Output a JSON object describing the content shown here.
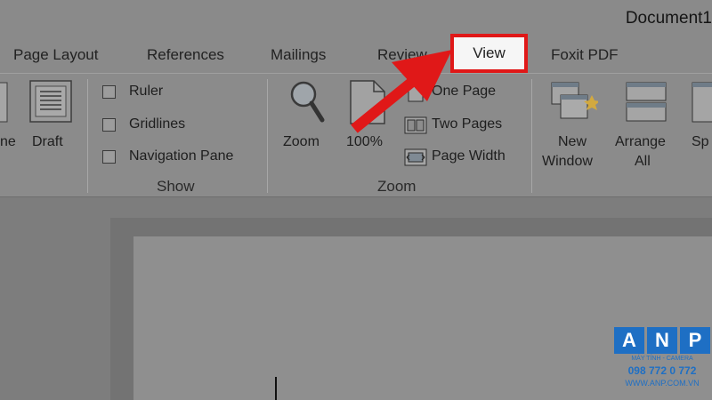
{
  "window": {
    "title": "Document1"
  },
  "tabs": [
    "Page Layout",
    "References",
    "Mailings",
    "Review",
    "View",
    "Foxit PDF"
  ],
  "ribbon": {
    "views": {
      "partial_label": "ne",
      "draft_label": "Draft"
    },
    "show": {
      "items": [
        "Ruler",
        "Gridlines",
        "Navigation Pane"
      ],
      "group_label": "Show"
    },
    "zoom": {
      "zoom_label": "Zoom",
      "hundred_label": "100%",
      "one_page_label": "One Page",
      "two_pages_label": "Two Pages",
      "page_width_label": "Page Width",
      "group_label": "Zoom"
    },
    "window": {
      "new_window_label": [
        "New",
        "Window"
      ],
      "arrange_all_label": [
        "Arrange",
        "All"
      ],
      "split_label": "Sp"
    }
  },
  "watermark": {
    "letters": [
      "A",
      "N",
      "P"
    ],
    "tagline": "MÁY TÍNH - CAMERA",
    "phone": "098 772 0 772",
    "website": "WWW.ANP.COM.VN"
  },
  "colors": {
    "highlight": "#e01818",
    "brand": "#1e6fc4"
  },
  "icons": [
    "magnifier-icon",
    "page-icon",
    "one-page-icon",
    "two-pages-icon",
    "page-width-icon",
    "new-window-icon",
    "arrange-all-icon",
    "split-icon",
    "draft-icon",
    "arrow-icon"
  ]
}
